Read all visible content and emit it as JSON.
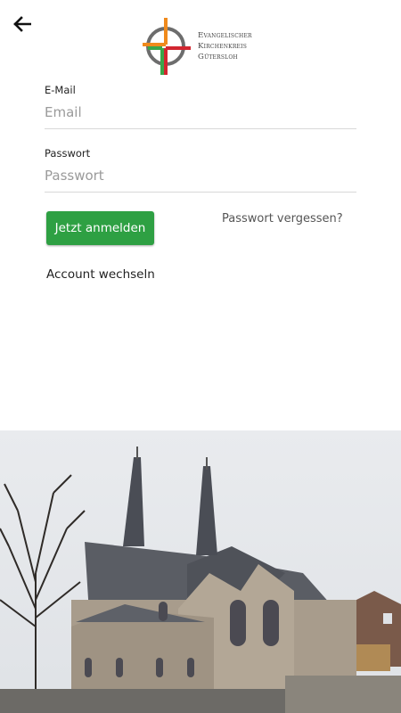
{
  "header": {
    "back_icon": "arrow-left-icon",
    "logo": {
      "line1": "Evangelischer",
      "line2": "Kirchenkreis",
      "line3": "Gütersloh",
      "colors": {
        "orange": "#f08a1c",
        "green": "#3aa64a",
        "red": "#d22630",
        "gray": "#6d6d6d"
      }
    }
  },
  "form": {
    "email": {
      "label": "E-Mail",
      "placeholder": "Email",
      "value": ""
    },
    "password": {
      "label": "Passwort",
      "placeholder": "Passwort",
      "value": ""
    },
    "login_button": "Jetzt anmelden",
    "forgot_link": "Passwort vergessen?",
    "switch_account": "Account wechseln"
  },
  "colors": {
    "accent": "#2ea043"
  },
  "footer_image": {
    "subject": "church-photo"
  }
}
